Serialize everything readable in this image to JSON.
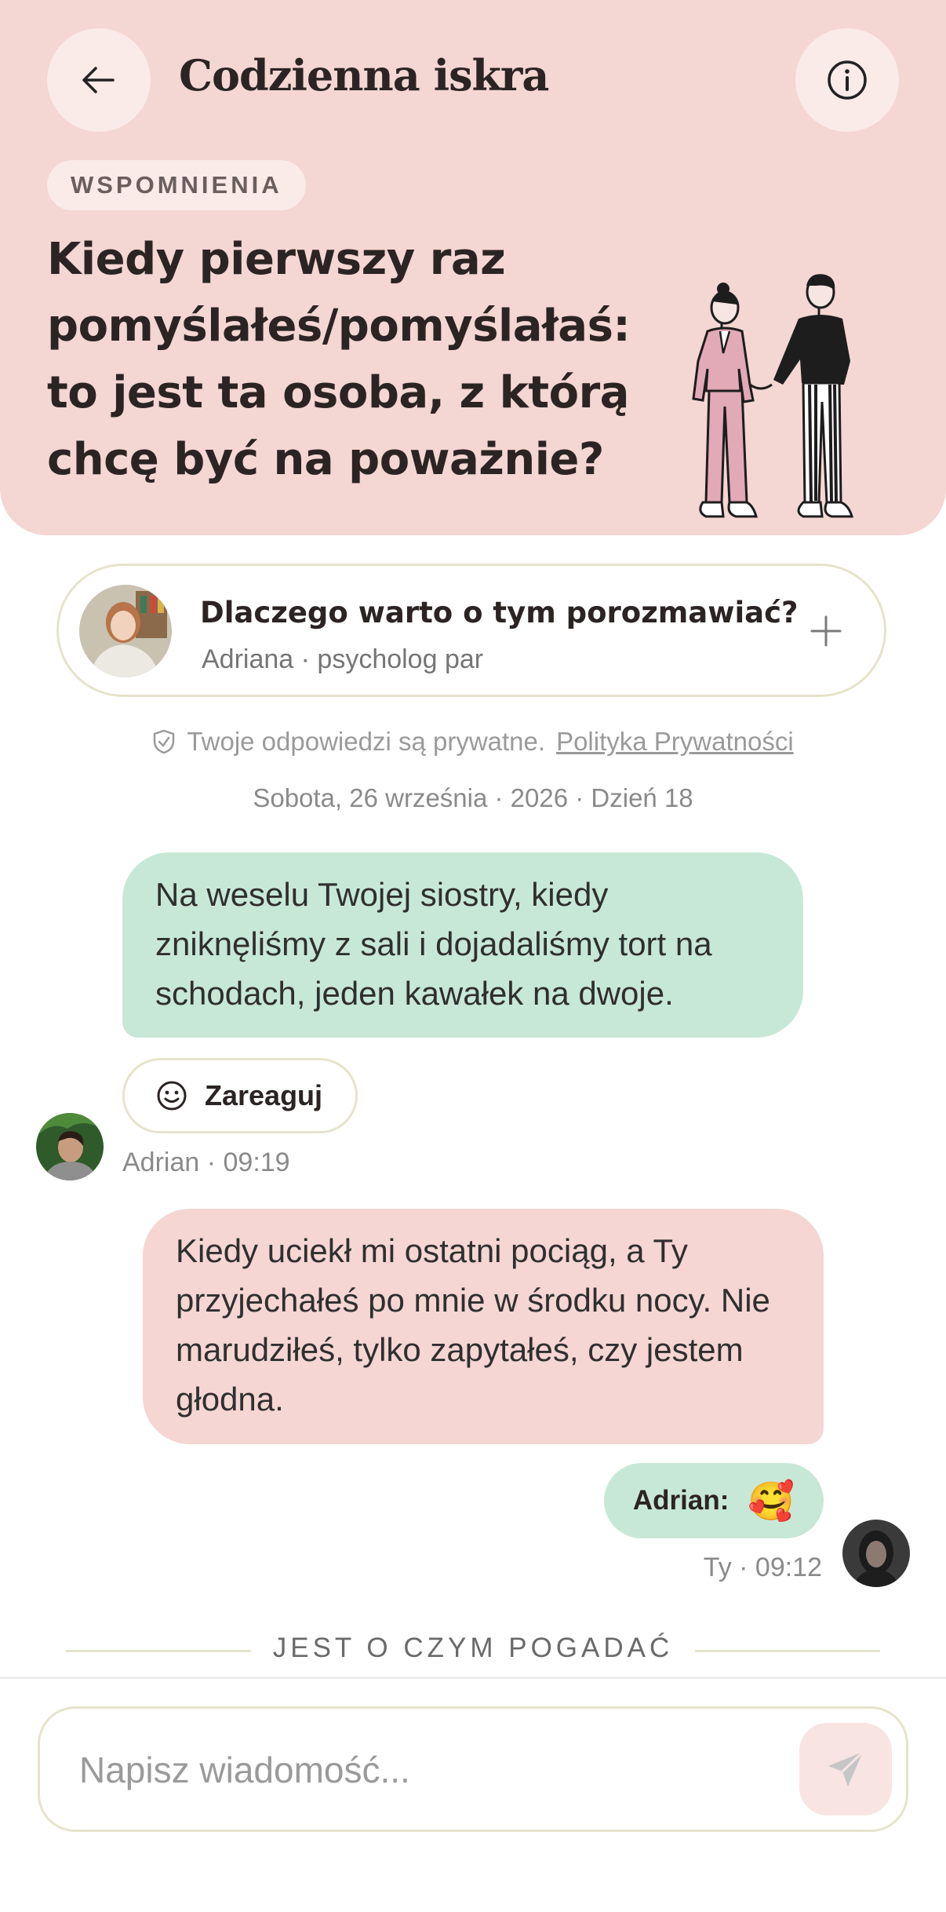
{
  "header": {
    "title": "Codzienna iskra",
    "back_icon": "arrow-left-icon",
    "info_icon": "info-icon",
    "category": "WSPOMNIENIA",
    "question": "Kiedy pierwszy raz pomyślałeś/pomyślałaś: to jest ta osoba, z którą chcę być na poważnie?",
    "illustration": "couple-holding-hands-illustration",
    "background": "#f4d6d2"
  },
  "expert": {
    "title": "Dlaczego warto o tym porozmawiać?",
    "subtitle": "Adriana · psycholog par",
    "expand_icon": "plus-icon"
  },
  "privacy": {
    "text": "Twoje odpowiedzi są prywatne.",
    "link": "Polityka Prywatności",
    "icon": "shield-check-icon"
  },
  "date_line": "Sobota, 26 września · 2026 · Dzień 18",
  "messages": [
    {
      "text": "Na weselu Twojej siostry, kiedy zniknęliśmy z sali i dojadaliśmy tort na schodach, jeden kawałek na dwoje.",
      "author": "Adrian · 09:19",
      "react_label": "Zareaguj",
      "color": "#c8e8d7"
    },
    {
      "text": "Kiedy uciekł mi ostatni pociąg, a Ty przyjechałeś po mnie w środku nocy. Nie marudziłeś, tylko zapytałeś, czy jestem głodna.",
      "author": "Ty · 09:12",
      "reaction_label": "Adrian:",
      "reaction_emoji": "🥰",
      "color": "#f5d6d2"
    }
  ],
  "divider": "JEST O CZYM POGADAĆ",
  "composer": {
    "placeholder": "Napisz wiadomość...",
    "send_icon": "send-icon"
  }
}
